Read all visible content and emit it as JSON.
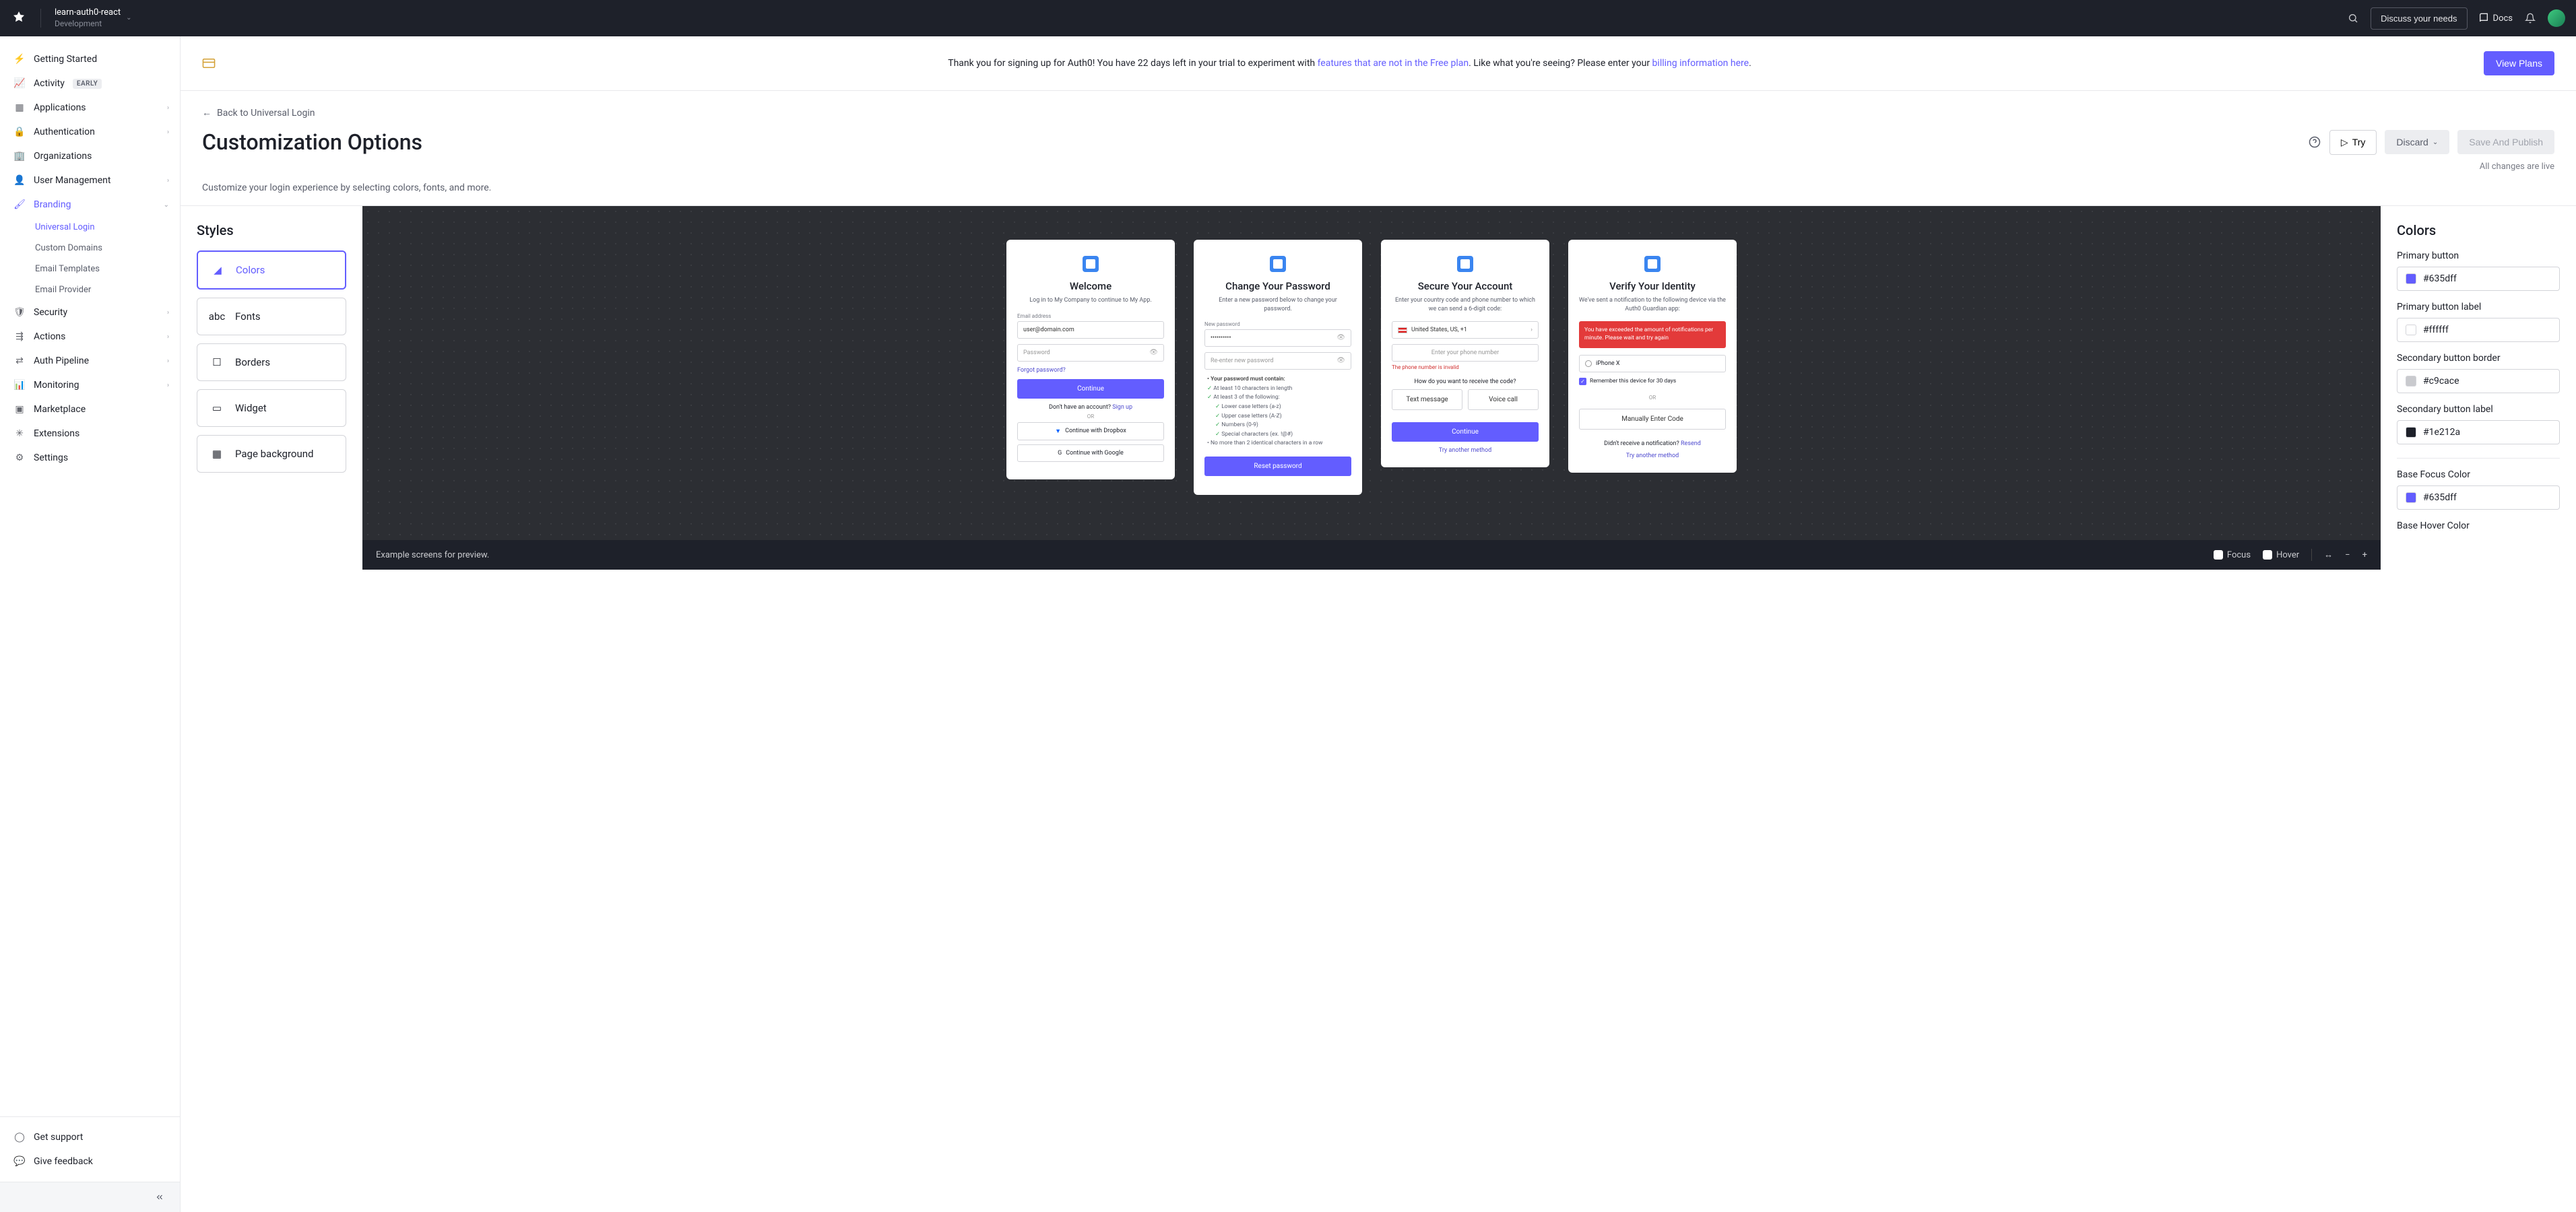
{
  "topbar": {
    "tenant_name": "learn-auth0-react",
    "tenant_env": "Development",
    "discuss": "Discuss your needs",
    "docs": "Docs"
  },
  "sidebar": {
    "items": [
      {
        "label": "Getting Started",
        "icon": "⚡"
      },
      {
        "label": "Activity",
        "icon": "📈",
        "badge": "EARLY"
      },
      {
        "label": "Applications",
        "icon": "▦",
        "expandable": true
      },
      {
        "label": "Authentication",
        "icon": "🔒",
        "expandable": true
      },
      {
        "label": "Organizations",
        "icon": "🏢"
      },
      {
        "label": "User Management",
        "icon": "👤",
        "expandable": true
      },
      {
        "label": "Branding",
        "icon": "🖌",
        "expandable": true,
        "active": true
      },
      {
        "label": "Security",
        "icon": "🛡",
        "expandable": true
      },
      {
        "label": "Actions",
        "icon": "⇶",
        "expandable": true
      },
      {
        "label": "Auth Pipeline",
        "icon": "⇄",
        "expandable": true
      },
      {
        "label": "Monitoring",
        "icon": "📊",
        "expandable": true
      },
      {
        "label": "Marketplace",
        "icon": "▣"
      },
      {
        "label": "Extensions",
        "icon": "✳"
      },
      {
        "label": "Settings",
        "icon": "⚙"
      }
    ],
    "branding_children": [
      {
        "label": "Universal Login",
        "active": true
      },
      {
        "label": "Custom Domains"
      },
      {
        "label": "Email Templates"
      },
      {
        "label": "Email Provider"
      }
    ],
    "support": "Get support",
    "feedback": "Give feedback"
  },
  "banner": {
    "pre": "Thank you for signing up for Auth0! You have 22 days left in your trial to experiment with ",
    "link1": "features that are not in the Free plan",
    "mid": ". Like what you're seeing? Please enter your ",
    "link2": "billing information here",
    "post": ".",
    "cta": "View Plans"
  },
  "page": {
    "back": "Back to Universal Login",
    "title": "Customization Options",
    "try": "Try",
    "discard": "Discard",
    "save": "Save And Publish",
    "status": "All changes are live",
    "desc": "Customize your login experience by selecting colors, fonts, and more."
  },
  "styles": {
    "title": "Styles",
    "cards": [
      "Colors",
      "Fonts",
      "Borders",
      "Widget",
      "Page background"
    ]
  },
  "preview": {
    "footer_text": "Example screens for preview.",
    "focus": "Focus",
    "hover": "Hover",
    "screens": {
      "welcome": {
        "title": "Welcome",
        "sub": "Log in to My Company to continue to My App.",
        "email_label": "Email address",
        "email_value": "user@domain.com",
        "password_placeholder": "Password",
        "forgot": "Forgot password?",
        "continue": "Continue",
        "no_account": "Don't have an account?",
        "signup": "Sign up",
        "or": "OR",
        "dropbox": "Continue with Dropbox",
        "google": "Continue with Google"
      },
      "change_pw": {
        "title": "Change Your Password",
        "sub": "Enter a new password below to change your password.",
        "new_label": "New password",
        "new_masked": "••••••••••",
        "reenter_placeholder": "Re-enter new password",
        "must_contain": "Your password must contain:",
        "r1": "At least 10 characters in length",
        "r2": "At least 3 of the following:",
        "r3": "Lower case letters (a-z)",
        "r4": "Upper case letters (A-Z)",
        "r5": "Numbers (0-9)",
        "r6": "Special characters (ex. !@#)",
        "r7": "No more than 2 identical characters in a row",
        "btn": "Reset password"
      },
      "secure": {
        "title": "Secure Your Account",
        "sub": "Enter your country code and phone number to which we can send a 6-digit code:",
        "country": "United States, US, +1",
        "phone_placeholder": "Enter your phone number",
        "error": "The phone number is invalid",
        "how": "How do you want to receive the code?",
        "text": "Text message",
        "voice": "Voice call",
        "continue": "Continue",
        "try_another": "Try another method"
      },
      "verify": {
        "title": "Verify Your Identity",
        "sub": "We've sent a notification to the following device via the Auth0 Guardian app:",
        "alert": "You have exceeded the amount of notifications per minute. Please wait and try again",
        "device": "iPhone X",
        "remember": "Remember this device for 30 days",
        "or": "OR",
        "manual": "Manually Enter Code",
        "no_notif": "Didn't receive a notification?",
        "resend": "Resend",
        "try_another": "Try another method"
      }
    }
  },
  "colors": {
    "title": "Colors",
    "fields": [
      {
        "label": "Primary button",
        "value": "#635dff"
      },
      {
        "label": "Primary button label",
        "value": "#ffffff"
      },
      {
        "label": "Secondary button border",
        "value": "#c9cace"
      },
      {
        "label": "Secondary button label",
        "value": "#1e212a"
      },
      {
        "label": "Base Focus Color",
        "value": "#635dff"
      },
      {
        "label": "Base Hover Color",
        "value": ""
      }
    ]
  }
}
